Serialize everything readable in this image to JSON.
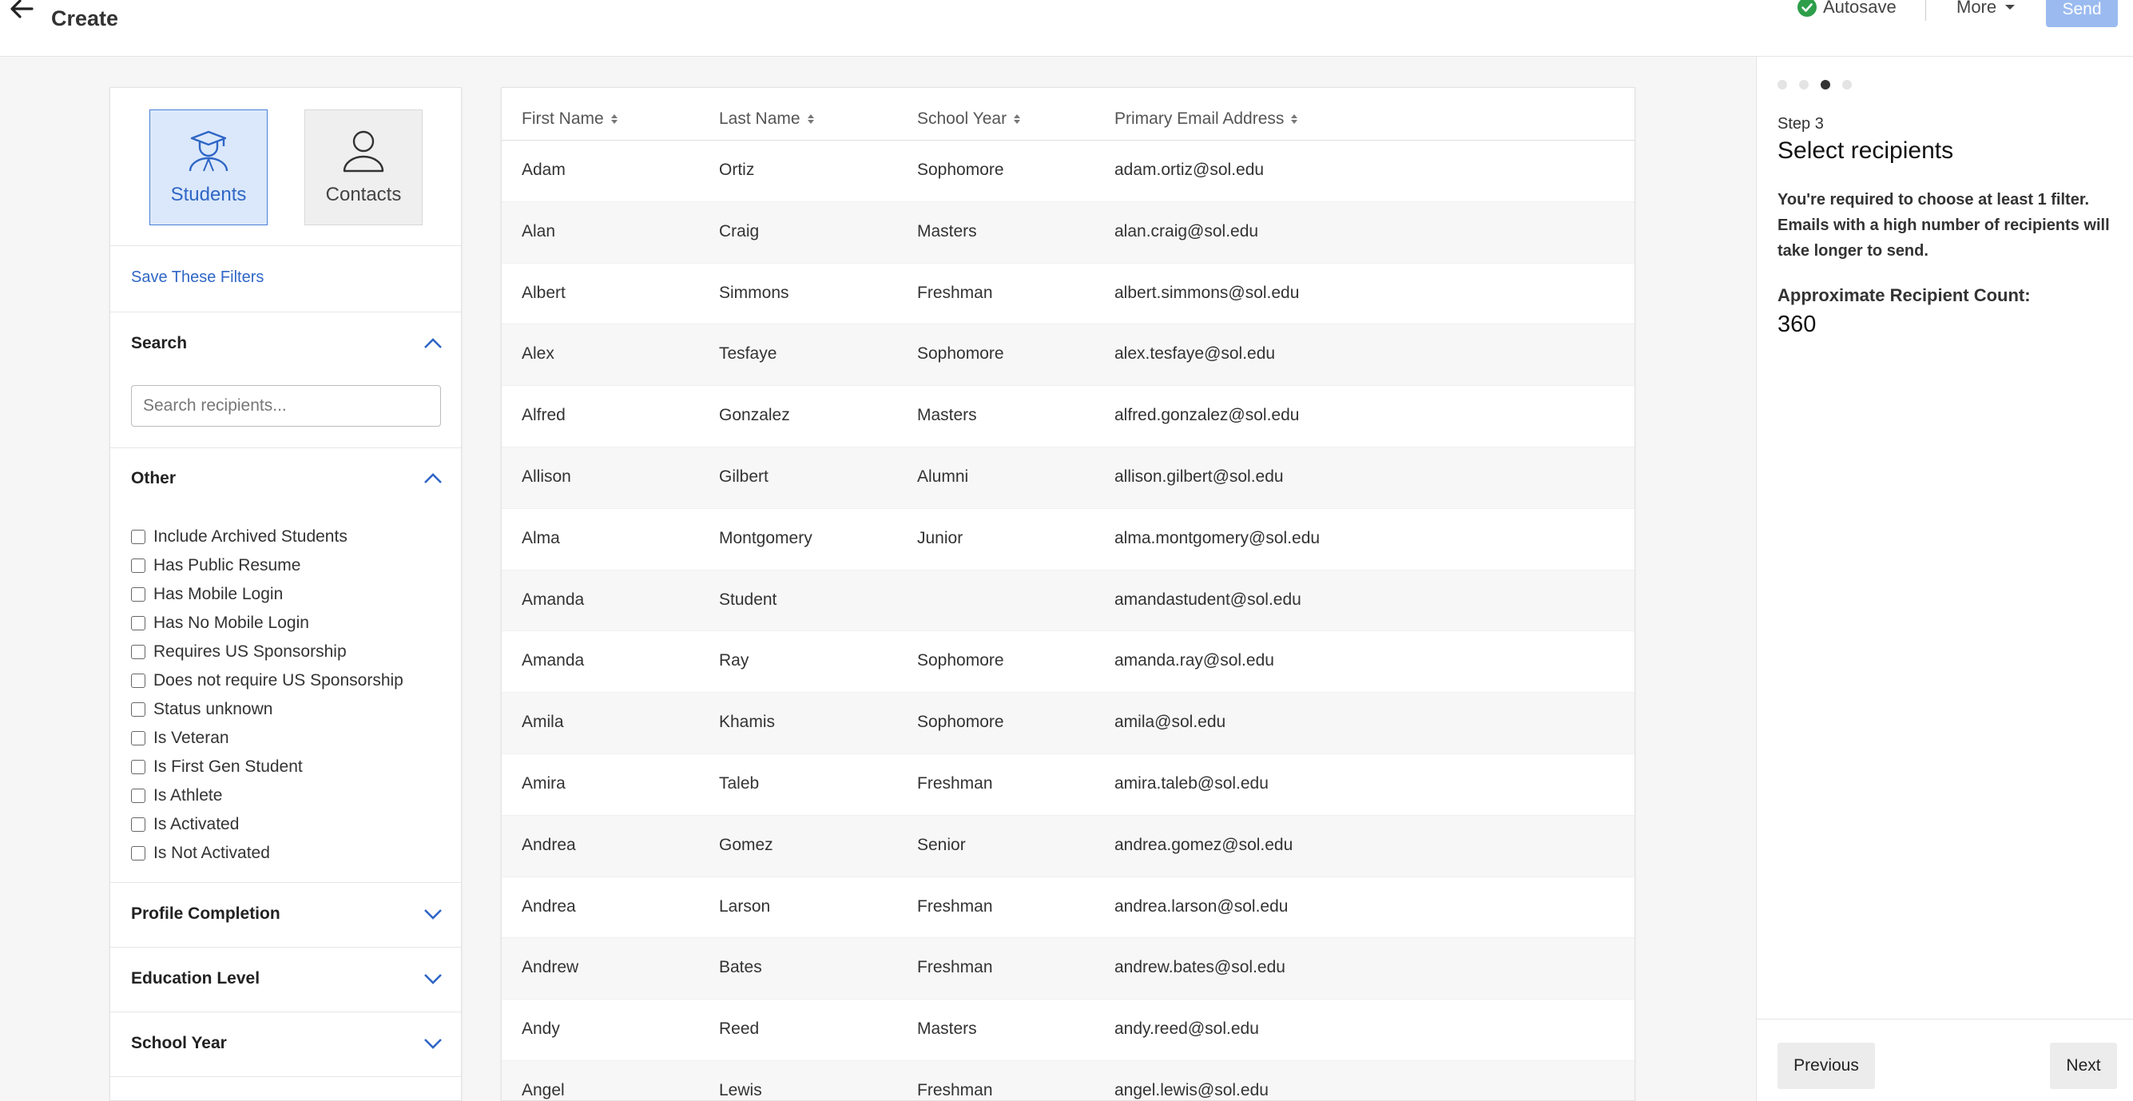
{
  "header": {
    "title": "Create",
    "autosave_label": "Autosave",
    "more_label": "More",
    "send_label": "Send"
  },
  "filters": {
    "types": [
      {
        "label": "Students",
        "icon": "student-graduate-icon",
        "selected": true
      },
      {
        "label": "Contacts",
        "icon": "person-icon",
        "selected": false
      }
    ],
    "save_label": "Save These Filters",
    "search": {
      "title": "Search",
      "placeholder": "Search recipients..."
    },
    "other": {
      "title": "Other",
      "options": [
        "Include Archived Students",
        "Has Public Resume",
        "Has Mobile Login",
        "Has No Mobile Login",
        "Requires US Sponsorship",
        "Does not require US Sponsorship",
        "Status unknown",
        "Is Veteran",
        "Is First Gen Student",
        "Is Athlete",
        "Is Activated",
        "Is Not Activated"
      ]
    },
    "collapsed_sections": [
      "Profile Completion",
      "Education Level",
      "School Year"
    ]
  },
  "table": {
    "columns": [
      "First Name",
      "Last Name",
      "School Year",
      "Primary Email Address"
    ],
    "rows": [
      [
        "Adam",
        "Ortiz",
        "Sophomore",
        "adam.ortiz@sol.edu"
      ],
      [
        "Alan",
        "Craig",
        "Masters",
        "alan.craig@sol.edu"
      ],
      [
        "Albert",
        "Simmons",
        "Freshman",
        "albert.simmons@sol.edu"
      ],
      [
        "Alex",
        "Tesfaye",
        "Sophomore",
        "alex.tesfaye@sol.edu"
      ],
      [
        "Alfred",
        "Gonzalez",
        "Masters",
        "alfred.gonzalez@sol.edu"
      ],
      [
        "Allison",
        "Gilbert",
        "Alumni",
        "allison.gilbert@sol.edu"
      ],
      [
        "Alma",
        "Montgomery",
        "Junior",
        "alma.montgomery@sol.edu"
      ],
      [
        "Amanda",
        "Student",
        "",
        "amandastudent@sol.edu"
      ],
      [
        "Amanda",
        "Ray",
        "Sophomore",
        "amanda.ray@sol.edu"
      ],
      [
        "Amila",
        "Khamis",
        "Sophomore",
        "amila@sol.edu"
      ],
      [
        "Amira",
        "Taleb",
        "Freshman",
        "amira.taleb@sol.edu"
      ],
      [
        "Andrea",
        "Gomez",
        "Senior",
        "andrea.gomez@sol.edu"
      ],
      [
        "Andrea",
        "Larson",
        "Freshman",
        "andrea.larson@sol.edu"
      ],
      [
        "Andrew",
        "Bates",
        "Freshman",
        "andrew.bates@sol.edu"
      ],
      [
        "Andy",
        "Reed",
        "Masters",
        "andy.reed@sol.edu"
      ],
      [
        "Angel",
        "Lewis",
        "Freshman",
        "angel.lewis@sol.edu"
      ]
    ]
  },
  "steps": {
    "total": 4,
    "current": 3,
    "step_label": "Step 3",
    "title": "Select recipients",
    "description": "You're required to choose at least 1 filter. Emails with a high number of recipients will take longer to send.",
    "count_label": "Approximate Recipient Count:",
    "count_value": "360",
    "previous_label": "Previous",
    "next_label": "Next"
  },
  "colors": {
    "accent": "#2f66c6",
    "send_disabled": "#9bbbf0",
    "autosave_check": "#2e9e4a"
  }
}
